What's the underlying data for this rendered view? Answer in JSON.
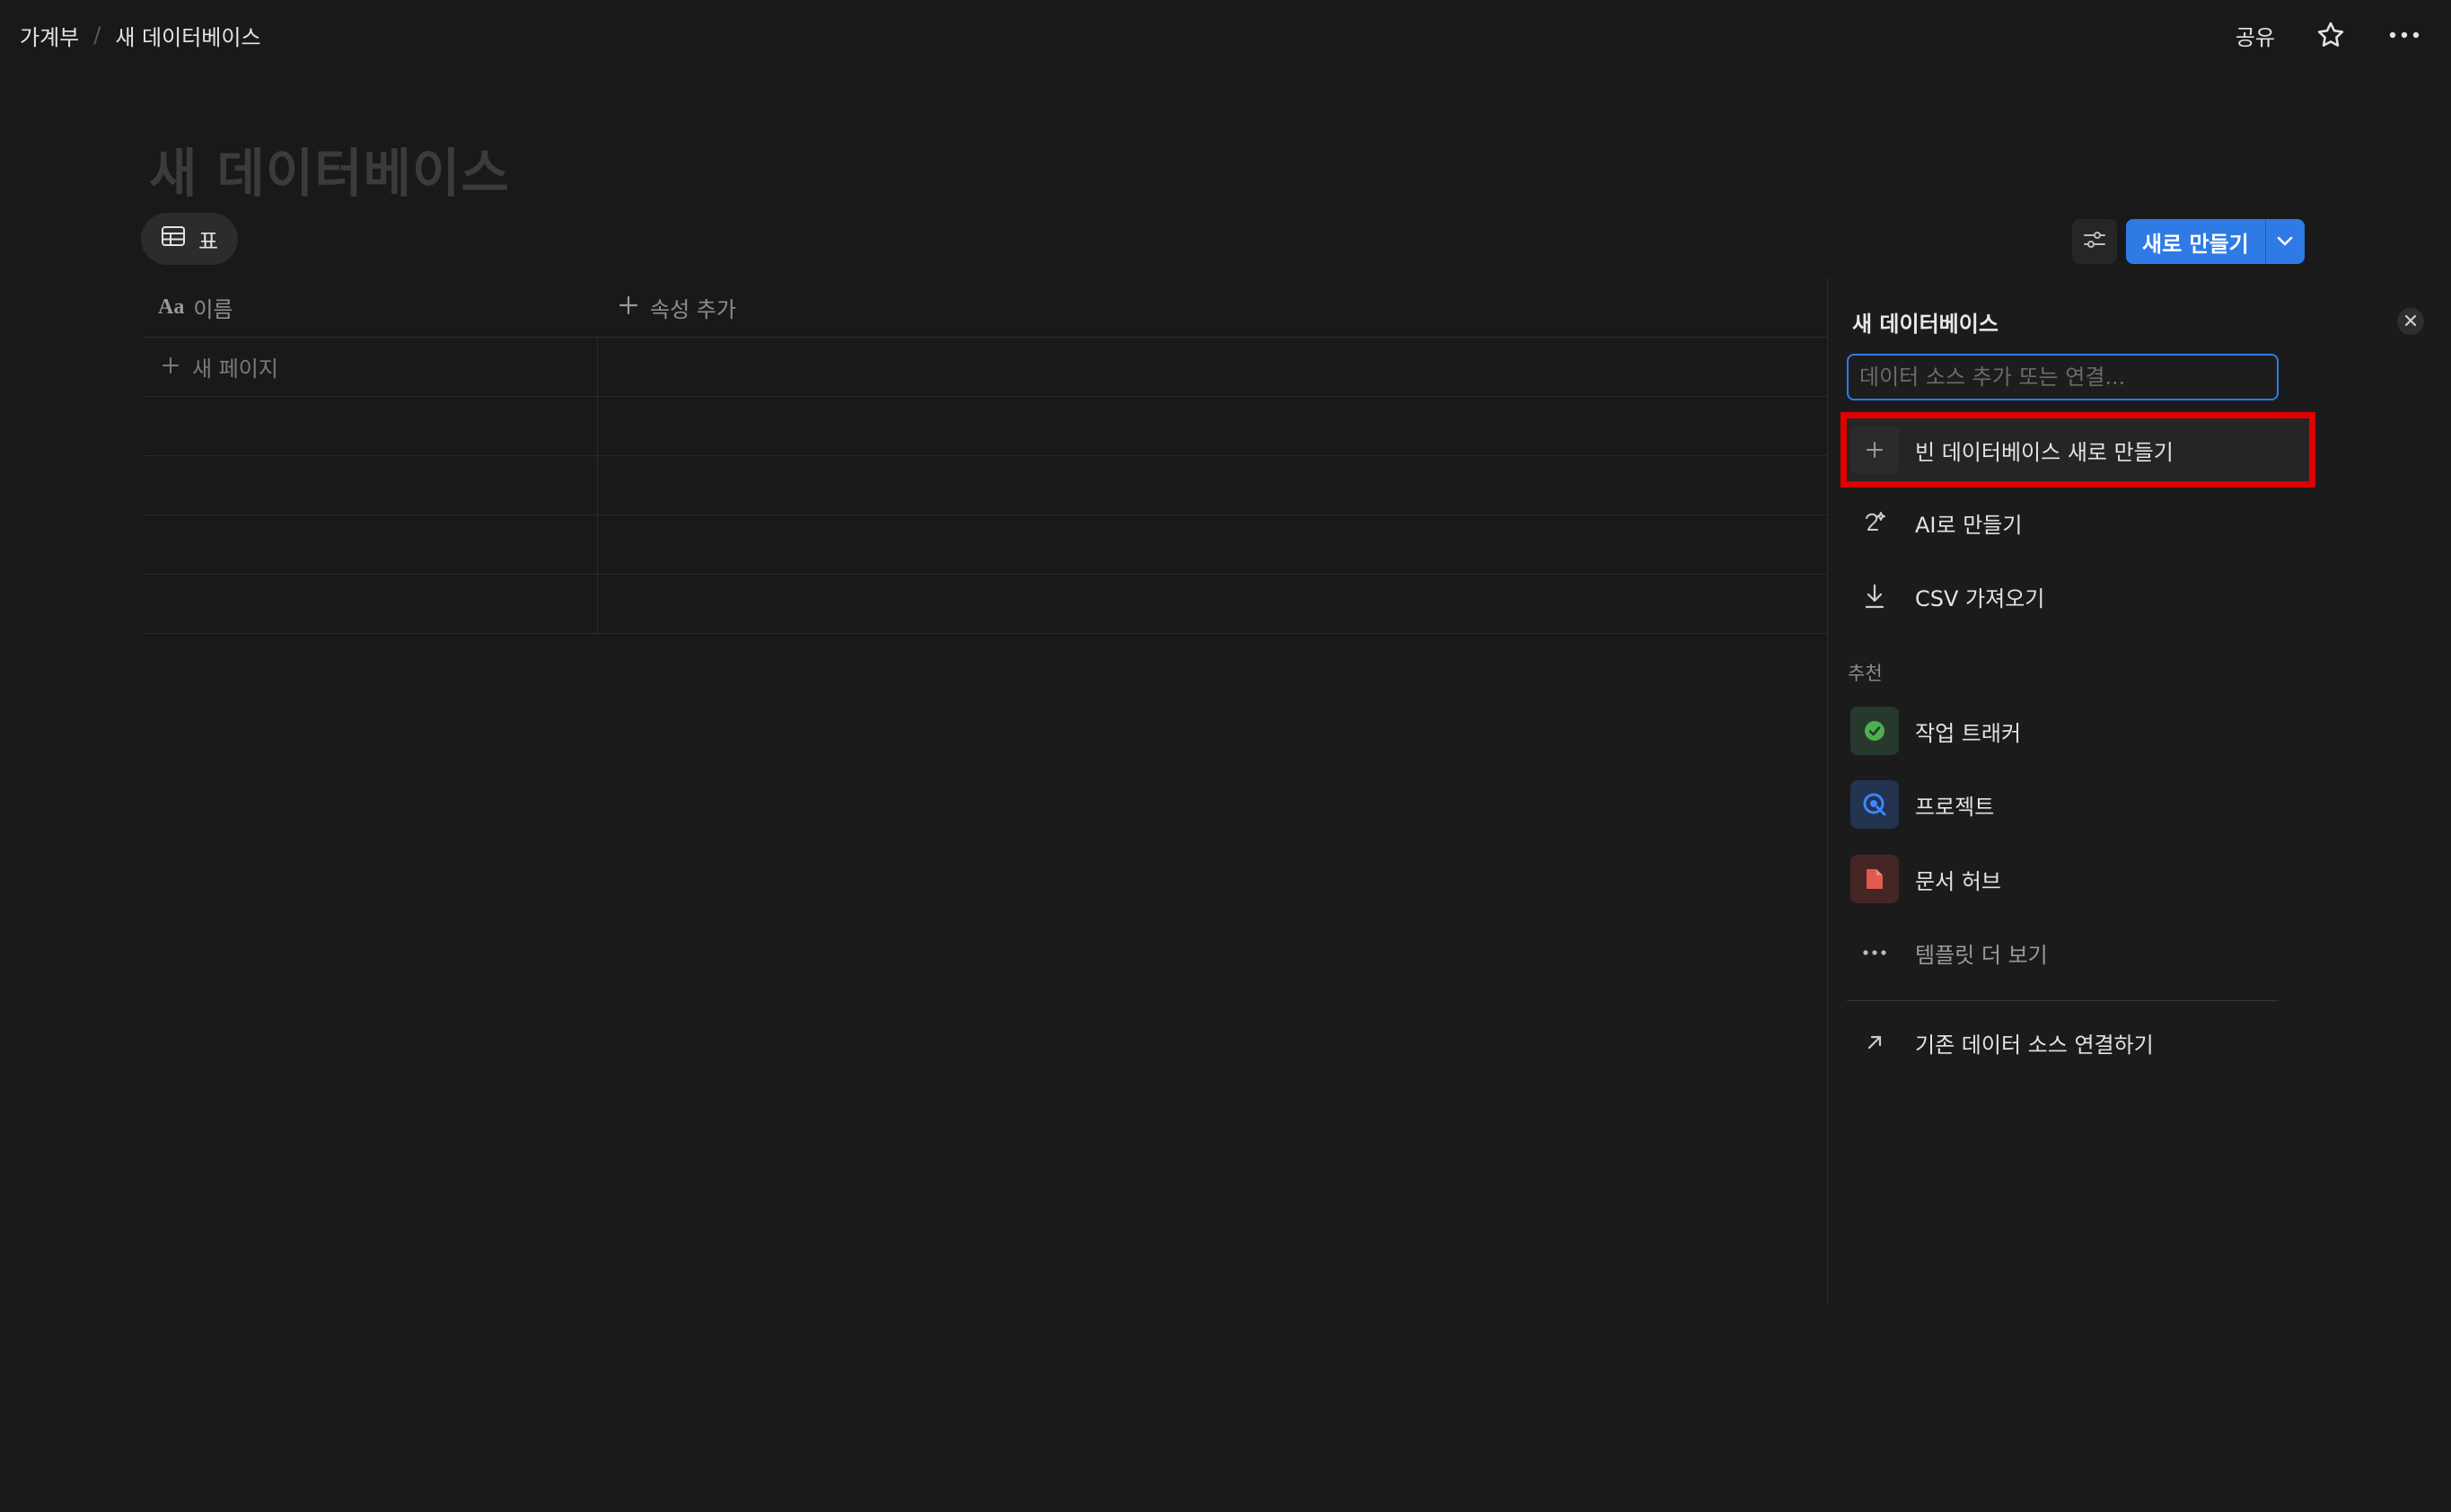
{
  "breadcrumb": {
    "parent": "가계부",
    "separator": "/",
    "current": "새 데이터베이스"
  },
  "topbar": {
    "share_label": "공유",
    "favorite_icon": "star-icon",
    "more_icon": "more-icon"
  },
  "database": {
    "title": "새 데이터베이스"
  },
  "views": {
    "active_tab": "표"
  },
  "toolbar": {
    "new_label": "새로 만들기"
  },
  "table": {
    "columns": [
      {
        "icon": "Aa",
        "label": "이름"
      }
    ],
    "add_property_label": "속성 추가",
    "new_page_label": "새 페이지"
  },
  "panel": {
    "title": "새 데이터베이스",
    "search_placeholder": "데이터 소스 추가 또는 연결...",
    "actions": [
      {
        "label": "빈 데이터베이스 새로 만들기",
        "icon": "plus-icon"
      },
      {
        "label": "AI로 만들기",
        "icon": "ai-icon"
      },
      {
        "label": "CSV 가져오기",
        "icon": "download-icon"
      }
    ],
    "suggested_label": "추천",
    "templates": [
      {
        "label": "작업 트래커",
        "icon": "check-circle-icon",
        "color": "#4caf50"
      },
      {
        "label": "프로젝트",
        "icon": "target-icon",
        "color": "#3a86ff"
      },
      {
        "label": "문서 허브",
        "icon": "document-icon",
        "color": "#e05a4f"
      }
    ],
    "more_templates_label": "템플릿 더 보기",
    "link_existing_label": "기존 데이터 소스 연결하기"
  },
  "colors": {
    "accent": "#2f7be5",
    "highlight": "#e00000",
    "background": "#191919"
  }
}
